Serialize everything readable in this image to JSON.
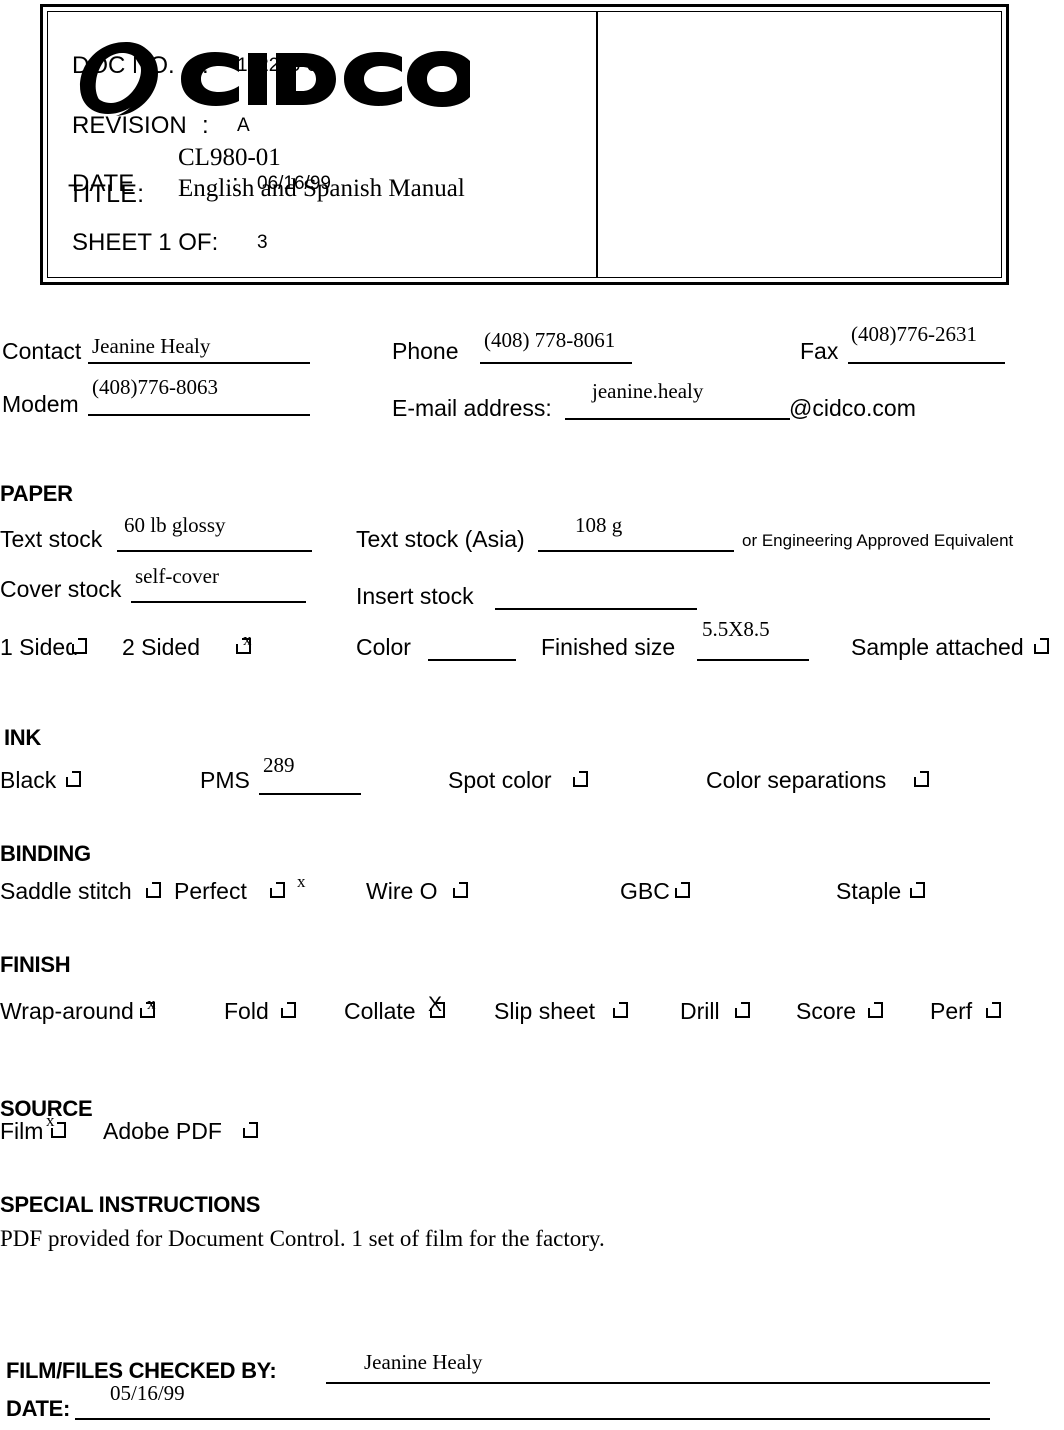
{
  "header": {
    "logo_text": "CIDCO",
    "logo_mark": "registered-trademark",
    "title_label": "TITLE:",
    "title_line1": "CL980-01",
    "title_line2": "English and Spanish Manual",
    "fields": [
      {
        "label": "DOC NO.",
        "colon": ":",
        "value": "102230-01"
      },
      {
        "label": "REVISION",
        "colon": ":",
        "value": "A"
      },
      {
        "label": "DATE",
        "colon": ":",
        "value": "06/16/99"
      },
      {
        "label": "SHEET 1 OF:",
        "colon": "",
        "value": "3"
      }
    ]
  },
  "contact": {
    "contact_label": "Contact",
    "contact_value": "Jeanine Healy",
    "phone_label": "Phone",
    "phone_value": "(408) 778-8061",
    "fax_label": "Fax",
    "fax_value": "(408)776-2631",
    "modem_label": "Modem",
    "modem_value": "(408)776-8063",
    "email_label": "E-mail address:",
    "email_value": "jeanine.healy",
    "email_domain": "@cidco.com"
  },
  "paper": {
    "heading": "PAPER",
    "text_stock_label": "Text stock",
    "text_stock_value": "60 lb glossy",
    "text_stock_asia_label": "Text stock (Asia)",
    "text_stock_asia_value": "108 g",
    "equivalent_note": "or Engineering Approved Equivalent",
    "cover_stock_label": "Cover stock",
    "cover_stock_value": "self-cover",
    "insert_stock_label": "Insert stock",
    "insert_stock_value": "",
    "one_sided_label": "1 Sided",
    "one_sided_checked": false,
    "two_sided_label": "2 Sided",
    "two_sided_checked": true,
    "two_sided_mark": "x",
    "color_label": "Color",
    "color_value": "",
    "finished_size_label": "Finished size",
    "finished_size_value": "5.5X8.5",
    "sample_attached_label": "Sample attached",
    "sample_attached_checked": false
  },
  "ink": {
    "heading": "INK",
    "black_label": "Black",
    "black_checked": false,
    "pms_label": "PMS",
    "pms_value": "289",
    "spot_color_label": "Spot color",
    "spot_color_checked": false,
    "color_separations_label": "Color separations",
    "color_separations_checked": false
  },
  "binding": {
    "heading": "BINDING",
    "saddle_stitch_label": "Saddle stitch",
    "saddle_stitch_checked": false,
    "perfect_label": "Perfect",
    "perfect_checked": true,
    "perfect_mark": "x",
    "wire_o_label": "Wire O",
    "wire_o_checked": false,
    "gbc_label": "GBC",
    "gbc_checked": false,
    "staple_label": "Staple",
    "staple_checked": false
  },
  "finish": {
    "heading": "FINISH",
    "wrap_around_label": "Wrap-around",
    "wrap_around_checked": true,
    "wrap_around_mark": "x",
    "fold_label": "Fold",
    "fold_checked": false,
    "collate_label": "Collate",
    "collate_checked": true,
    "collate_mark": "X",
    "slip_sheet_label": "Slip sheet",
    "slip_sheet_checked": false,
    "drill_label": "Drill",
    "drill_checked": false,
    "score_label": "Score",
    "score_checked": false,
    "perf_label": "Perf",
    "perf_checked": false
  },
  "source": {
    "heading": "SOURCE",
    "film_label": "Film",
    "film_checked": true,
    "film_mark": "x",
    "adobe_pdf_label": "Adobe PDF",
    "adobe_pdf_checked": false
  },
  "special_instructions": {
    "heading": "SPECIAL INSTRUCTIONS",
    "text": "PDF provided for Document Control.  1 set of film for the factory."
  },
  "signoff": {
    "checked_by_label": "FILM/FILES CHECKED BY:",
    "checked_by_value": "Jeanine Healy",
    "date_label": "DATE:",
    "date_value": "05/16/99"
  }
}
